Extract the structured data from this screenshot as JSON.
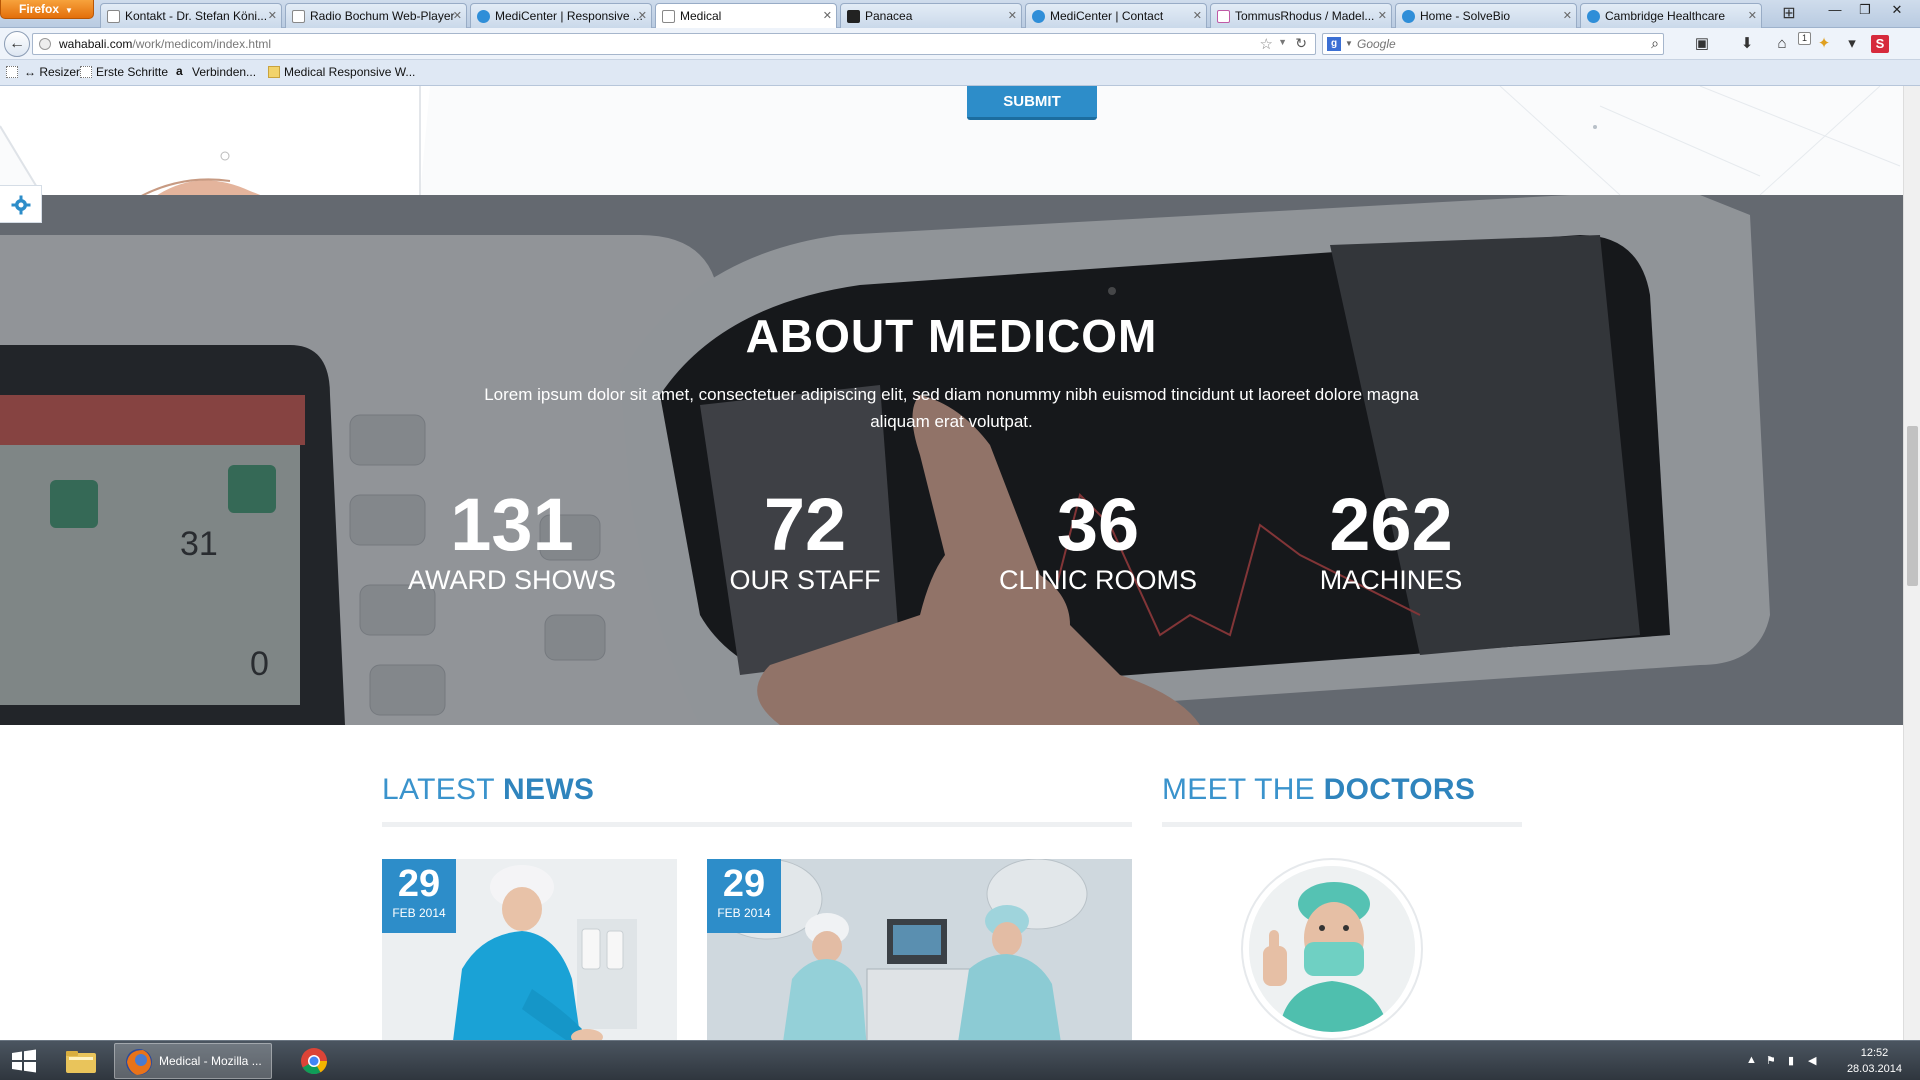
{
  "browser": {
    "menu_label": "Firefox",
    "tabs": [
      {
        "label": "Kontakt - Dr. Stefan Köni...",
        "icon": "blank"
      },
      {
        "label": "Radio Bochum Web-Player",
        "icon": "blank"
      },
      {
        "label": "MediCenter | Responsive ...",
        "icon": "blue"
      },
      {
        "label": "Medical",
        "icon": "blank",
        "active": true
      },
      {
        "label": "Panacea",
        "icon": "dark"
      },
      {
        "label": "MediCenter | Contact",
        "icon": "blue"
      },
      {
        "label": "TommusRhodus / Madel...",
        "icon": "pink"
      },
      {
        "label": "Home - SolveBio",
        "icon": "blue"
      },
      {
        "label": "Cambridge Healthcare",
        "icon": "blue"
      }
    ],
    "url_host": "wahabali.com",
    "url_path": "/work/medicom/index.html",
    "search_placeholder": "Google",
    "download_badge": "1",
    "bookmarks": [
      {
        "label": "↔ Resizer"
      },
      {
        "label": "Erste Schritte"
      },
      {
        "label": "Verbinden..."
      },
      {
        "label": "Medical Responsive W..."
      }
    ]
  },
  "page": {
    "submit_label": "SUBMIT",
    "about": {
      "title": "ABOUT MEDICOM",
      "text": "Lorem ipsum dolor sit amet, consectetuer adipiscing elit, sed diam nonummy nibh euismod tincidunt ut laoreet dolore magna aliquam erat volutpat.",
      "stats": [
        {
          "number": "131",
          "label": "AWARD SHOWS"
        },
        {
          "number": "72",
          "label": "OUR STAFF"
        },
        {
          "number": "36",
          "label": "CLINIC ROOMS"
        },
        {
          "number": "262",
          "label": "MACHINES"
        }
      ]
    },
    "news": {
      "title_light": "LATEST",
      "title_bold": "NEWS",
      "items": [
        {
          "day": "29",
          "month": "FEB 2014"
        },
        {
          "day": "29",
          "month": "FEB 2014"
        }
      ]
    },
    "doctors": {
      "title_light": "MEET THE",
      "title_bold": "DOCTORS"
    }
  },
  "taskbar": {
    "firefox_label": "Medical - Mozilla ...",
    "clock_time": "12:52",
    "clock_date": "28.03.2014"
  },
  "colors": {
    "accent": "#2d8dc9",
    "firefox_orange": "#e36f0b"
  }
}
